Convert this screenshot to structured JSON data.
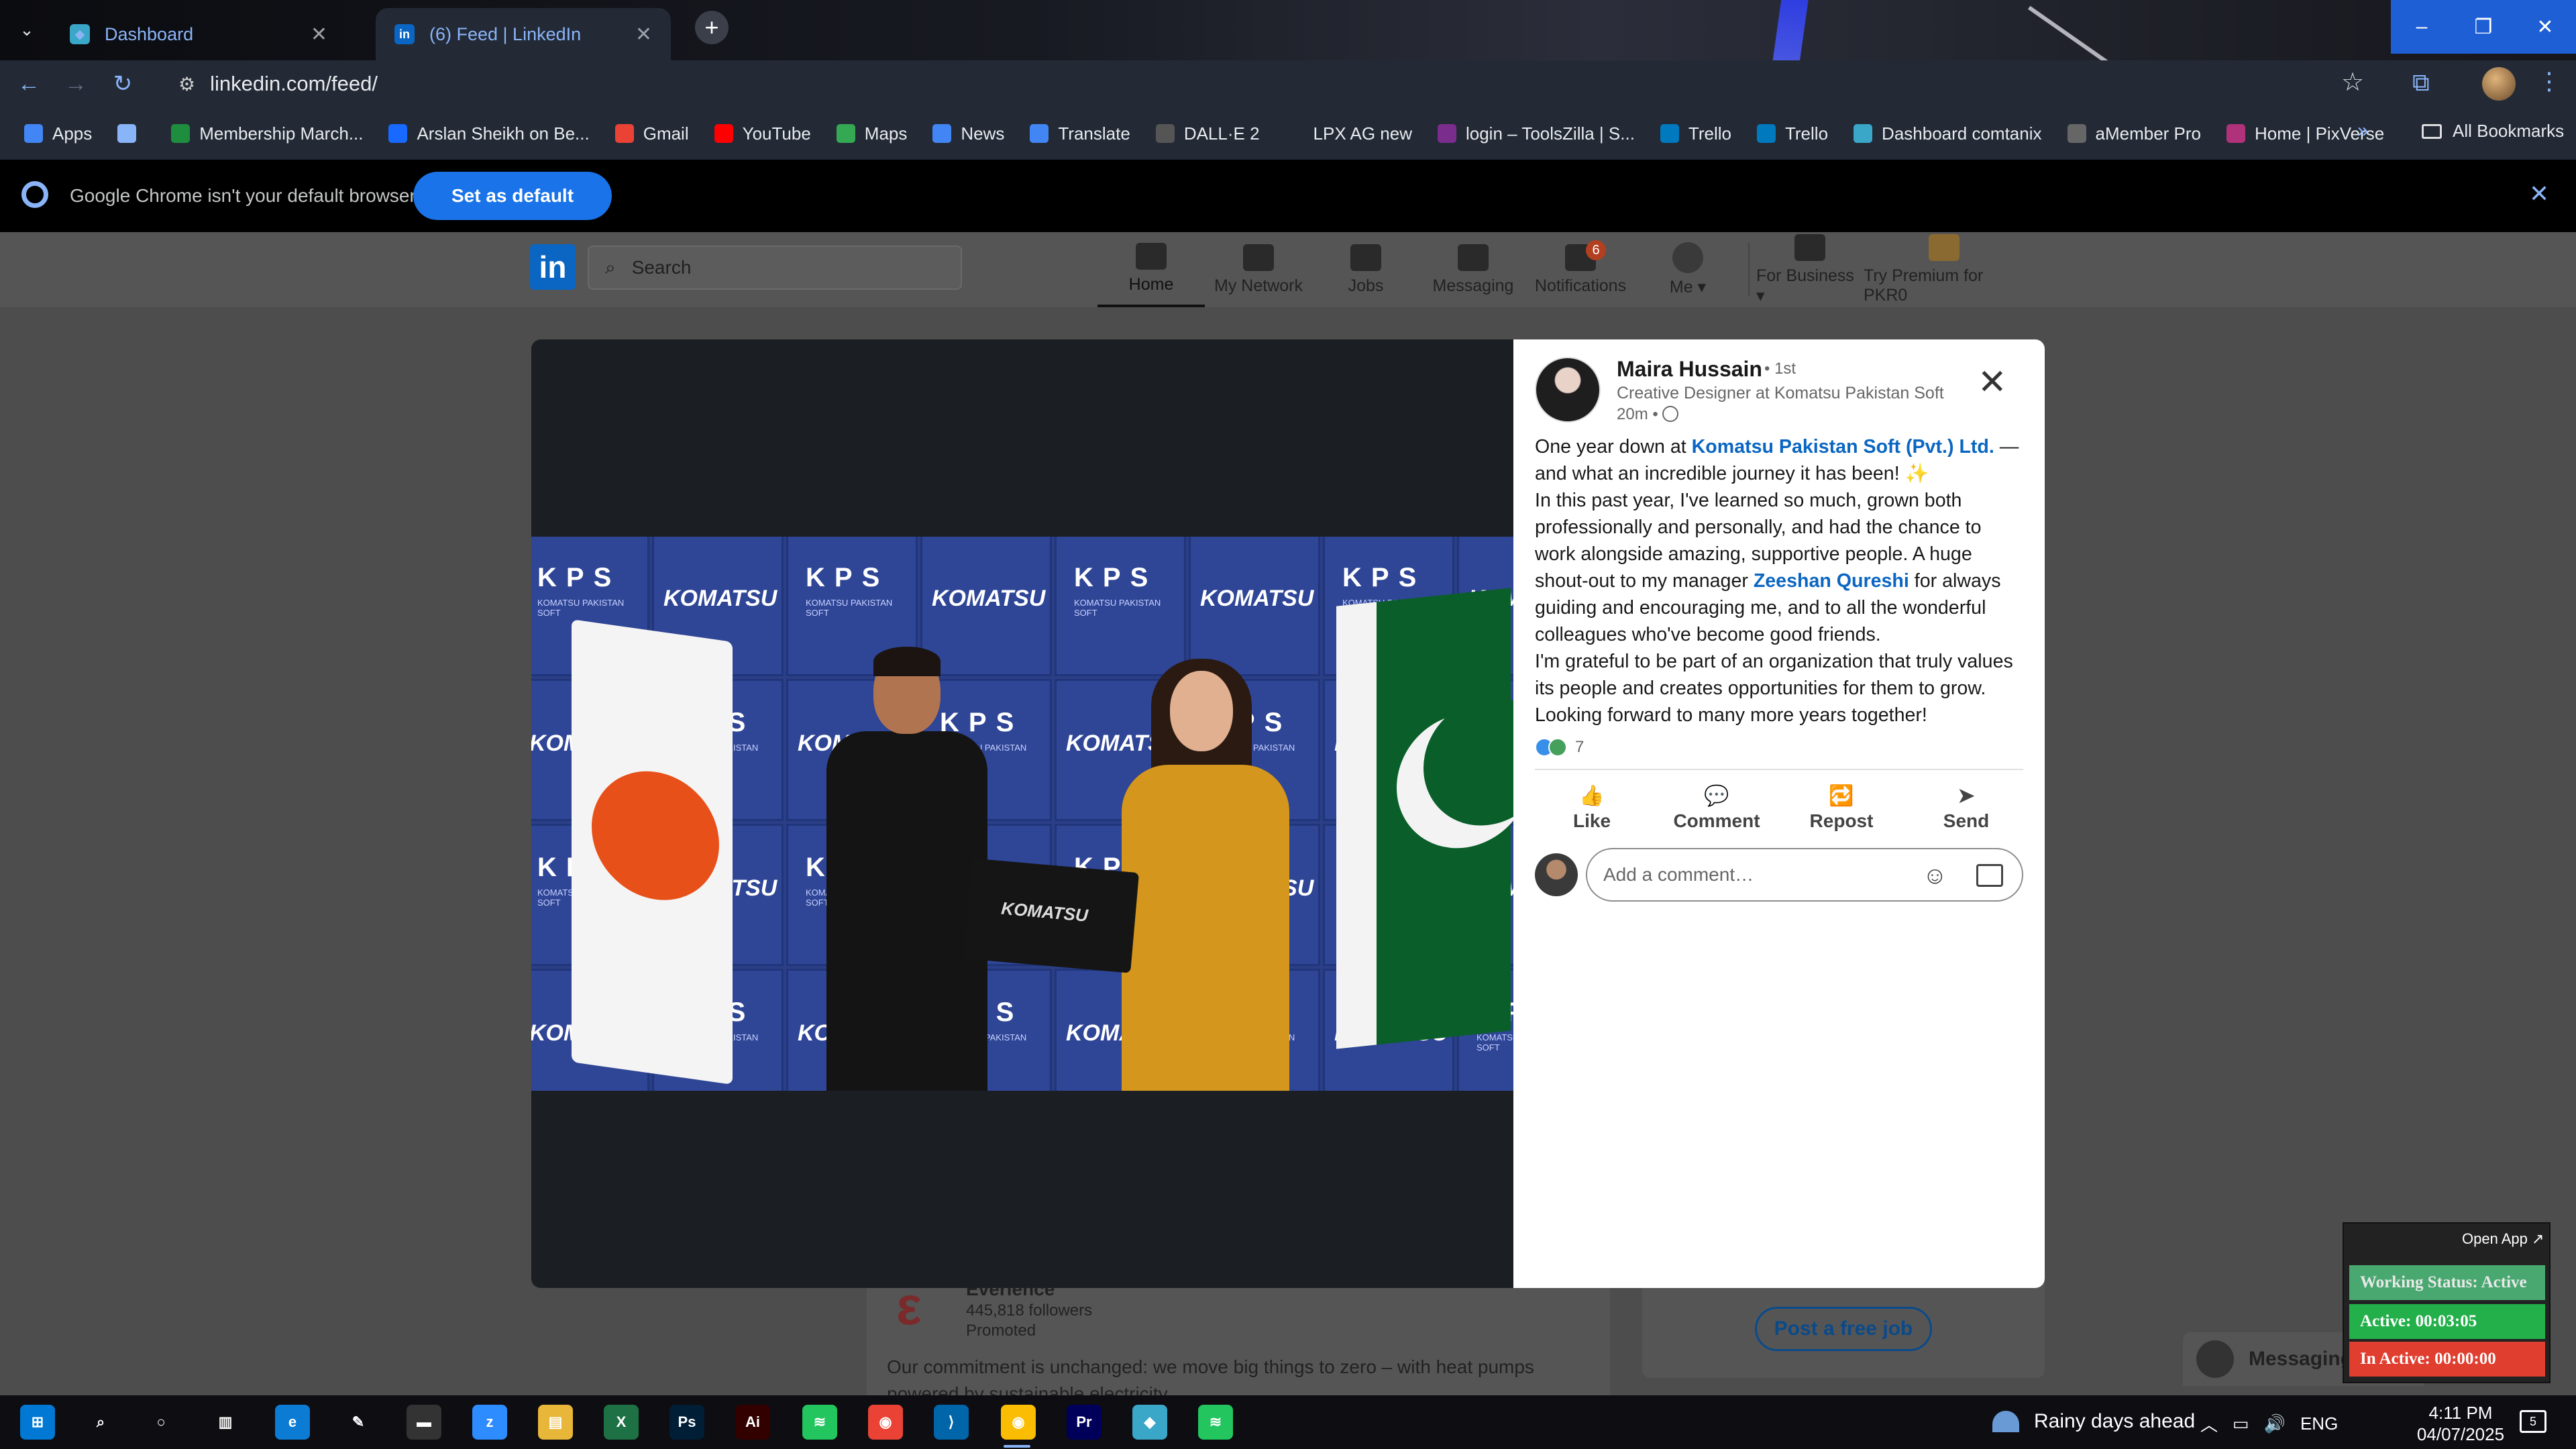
{
  "browser": {
    "tabs": [
      {
        "title": "Dashboard",
        "favicon_color": "#3aa6c8"
      },
      {
        "title": "(6) Feed | LinkedIn",
        "favicon_color": "#0a66c2"
      }
    ],
    "new_tab_label": "+",
    "url": "linkedin.com/feed/",
    "bookmarks": [
      {
        "label": "Apps",
        "icon": "apps-grid-icon",
        "color": "#4285f4"
      },
      {
        "label": "",
        "icon": "tab-groups-icon",
        "color": "#8ab4f8"
      },
      {
        "label": "Membership March...",
        "icon": "plus-green-icon",
        "color": "#1e8e3e"
      },
      {
        "label": "Arslan Sheikh on Be...",
        "icon": "behance-icon",
        "color": "#1769ff"
      },
      {
        "label": "Gmail",
        "icon": "gmail-icon",
        "color": "#ea4335"
      },
      {
        "label": "YouTube",
        "icon": "youtube-icon",
        "color": "#ff0000"
      },
      {
        "label": "Maps",
        "icon": "maps-icon",
        "color": "#34a853"
      },
      {
        "label": "News",
        "icon": "news-icon",
        "color": "#4285f4"
      },
      {
        "label": "Translate",
        "icon": "translate-icon",
        "color": "#4285f4"
      },
      {
        "label": "DALL·E 2",
        "icon": "openai-icon",
        "color": "#555555"
      },
      {
        "label": "LPX AG new",
        "icon": "dash-icon",
        "color": "#232a36"
      },
      {
        "label": "login – ToolsZilla | S...",
        "icon": "toolszilla-icon",
        "color": "#7b2d8e"
      },
      {
        "label": "Trello",
        "icon": "trello-icon",
        "color": "#0079bf"
      },
      {
        "label": "Trello",
        "icon": "trello-icon",
        "color": "#0079bf"
      },
      {
        "label": "Dashboard comtanix",
        "icon": "comtanix-icon",
        "color": "#3aa6c8"
      },
      {
        "label": "aMember Pro",
        "icon": "amember-icon",
        "color": "#666666"
      },
      {
        "label": "Home | PixVerse",
        "icon": "pixverse-icon",
        "color": "#b0327a"
      }
    ],
    "all_bookmarks": "All Bookmarks",
    "infobar": {
      "message": "Google Chrome isn't your default browser",
      "button": "Set as default"
    }
  },
  "linkedin": {
    "logo": "in",
    "search_placeholder": "Search",
    "nav": [
      {
        "label": "Home",
        "icon": "home-icon",
        "active": true
      },
      {
        "label": "My Network",
        "icon": "network-icon"
      },
      {
        "label": "Jobs",
        "icon": "jobs-icon"
      },
      {
        "label": "Messaging",
        "icon": "messaging-icon"
      },
      {
        "label": "Notifications",
        "icon": "bell-icon",
        "badge": "6"
      },
      {
        "label": "Me ▾",
        "icon": "avatar"
      },
      {
        "label": "For Business ▾",
        "icon": "grid-icon"
      },
      {
        "label": "Try Premium for PKR0",
        "icon": "premium-icon"
      }
    ],
    "background": {
      "company": "Everlence",
      "followers": "445,818 followers",
      "promoted": "Promoted",
      "text": "Our commitment is unchanged: we move big things to zero – with heat pumps powered by sustainable electricity.",
      "post_job": "Post a free job",
      "messaging": "Messaging"
    }
  },
  "modal": {
    "photo": {
      "kps": "KPS",
      "kps_sub": "KOMATSU PAKISTAN SOFT",
      "komatsu": "KOMATSU"
    },
    "author": {
      "name": "Maira Hussain",
      "degree": "• 1st",
      "headline": "Creative Designer at Komatsu Pakistan Soft",
      "time": "20m •"
    },
    "post": {
      "p1_a": "One year down at ",
      "p1_link": "Komatsu Pakistan Soft (Pvt.) Ltd.",
      "p1_b": " — and what an incredible journey it has been! ✨",
      "p2_a": "In this past year, I've learned so much, grown both professionally and personally, and had the chance to work alongside amazing, supportive people. A huge shout-out to my manager ",
      "p2_link": "Zeeshan Qureshi",
      "p2_b": " for always guiding and encouraging me, and to all the wonderful colleagues who've become good friends.",
      "p3": "I'm grateful to be part of an organization that truly values its people and creates opportunities for them to grow. Looking forward to many more years together!"
    },
    "reactions_count": "7",
    "actions": [
      {
        "label": "Like",
        "icon": "thumbs-up-icon",
        "glyph": "👍"
      },
      {
        "label": "Comment",
        "icon": "comment-icon",
        "glyph": "💬"
      },
      {
        "label": "Repost",
        "icon": "repost-icon",
        "glyph": "🔁"
      },
      {
        "label": "Send",
        "icon": "send-icon",
        "glyph": "➤"
      }
    ],
    "comment_placeholder": "Add a comment…"
  },
  "status_widget": {
    "open_app": "Open App ↗",
    "working": "Working Status: Active",
    "active": "Active: 00:03:05",
    "inactive": "In Active: 00:00:00"
  },
  "taskbar": {
    "weather": "Rainy days ahead",
    "lang": "ENG",
    "time": "4:11 PM",
    "date": "04/07/2025",
    "notifications": "5"
  }
}
